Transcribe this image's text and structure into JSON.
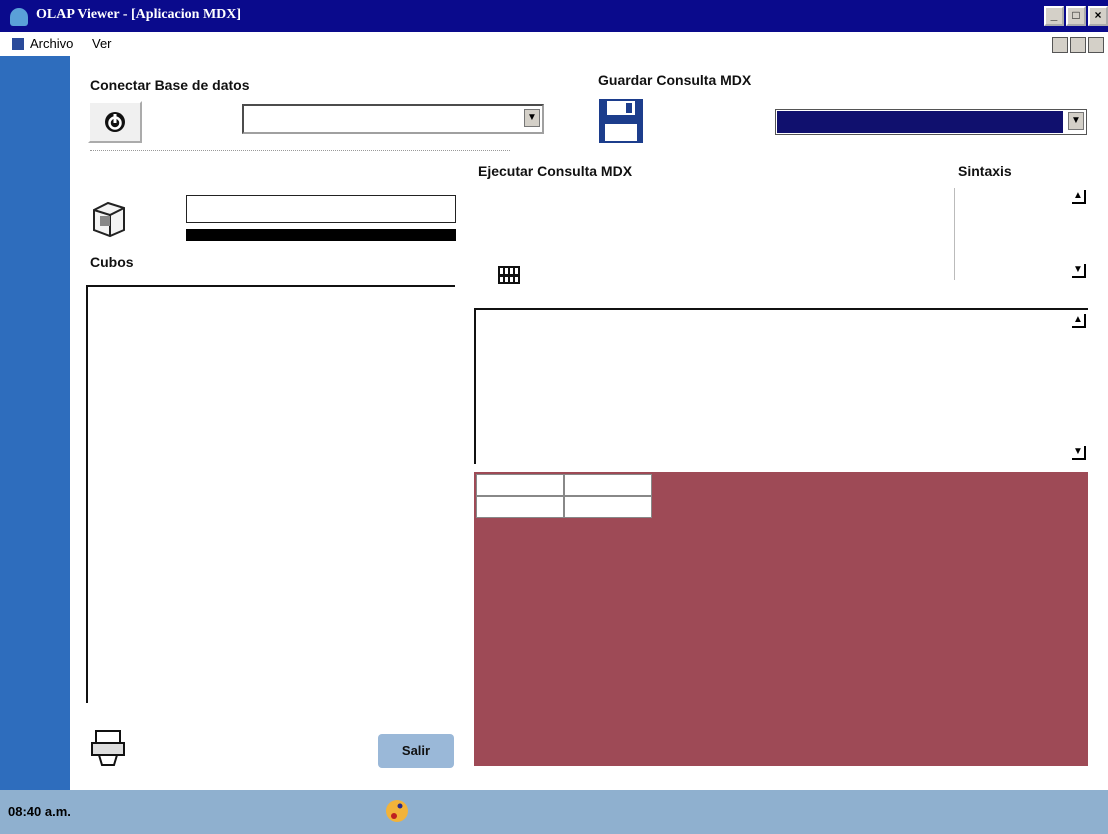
{
  "window": {
    "title": "OLAP Viewer - [Aplicacion MDX]",
    "controls": {
      "minimize": "_",
      "maximize": "□",
      "close": "×"
    }
  },
  "menu": {
    "items": [
      {
        "label": "Archivo",
        "hotkey": "A"
      },
      {
        "label": "Ver",
        "hotkey": "V"
      }
    ]
  },
  "connect": {
    "label": "Conectar Base de datos",
    "icon": "power-icon",
    "database_value": ""
  },
  "save": {
    "label": "Guardar Consulta MDX",
    "icon": "floppy-disk-icon",
    "saved_query_value": ""
  },
  "cubes": {
    "label": "Cubos",
    "icon": "cube-icon",
    "cube_name_value": ""
  },
  "execute": {
    "label": "Ejecutar Consulta MDX",
    "icon": "execute-icon"
  },
  "syntax": {
    "label": "Sintaxis"
  },
  "query_editor": {
    "value": ""
  },
  "results_grid": {
    "background": "#9e4a56",
    "cells": [
      [
        "",
        ""
      ],
      [
        "",
        ""
      ]
    ]
  },
  "footer": {
    "exit_label": "Salir",
    "print_icon": "printer-icon"
  },
  "statusbar": {
    "time": "08:40 a.m."
  },
  "colors": {
    "titlebar": "#0a0a8c",
    "sidebar": "#2e6dbd",
    "statusbar": "#8fb0cf",
    "selected_combo": "#10106e"
  }
}
